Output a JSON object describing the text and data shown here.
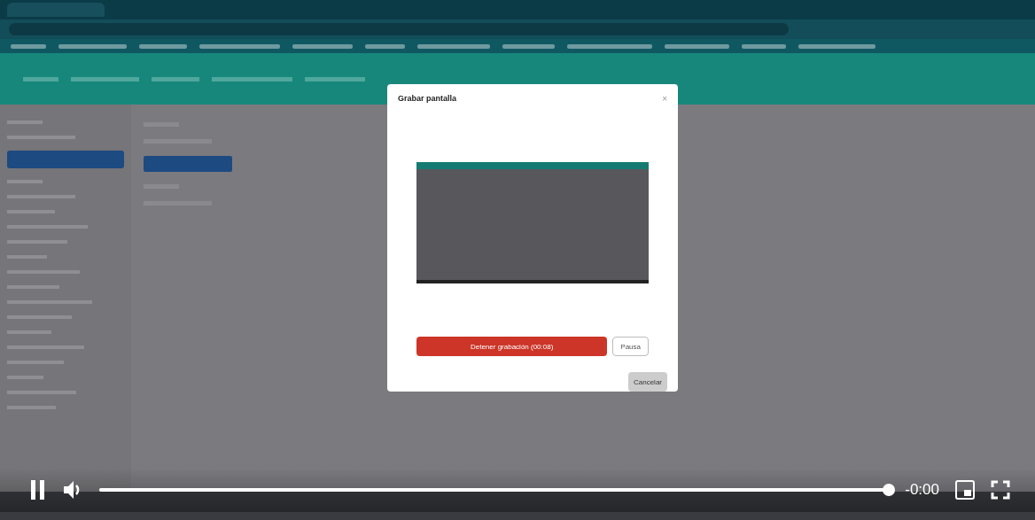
{
  "dialog": {
    "title": "Grabar pantalla",
    "close": "×",
    "buttons": [
      {
        "label": "Detener grabación (00:08)",
        "kind": "primary"
      },
      {
        "label": "Pausa",
        "kind": "secondary"
      },
      {
        "label": "Cancelar",
        "kind": "muted"
      }
    ]
  },
  "player": {
    "playing": true,
    "muted": false,
    "progress": {
      "level": 1
    },
    "time": "-0:00"
  }
}
